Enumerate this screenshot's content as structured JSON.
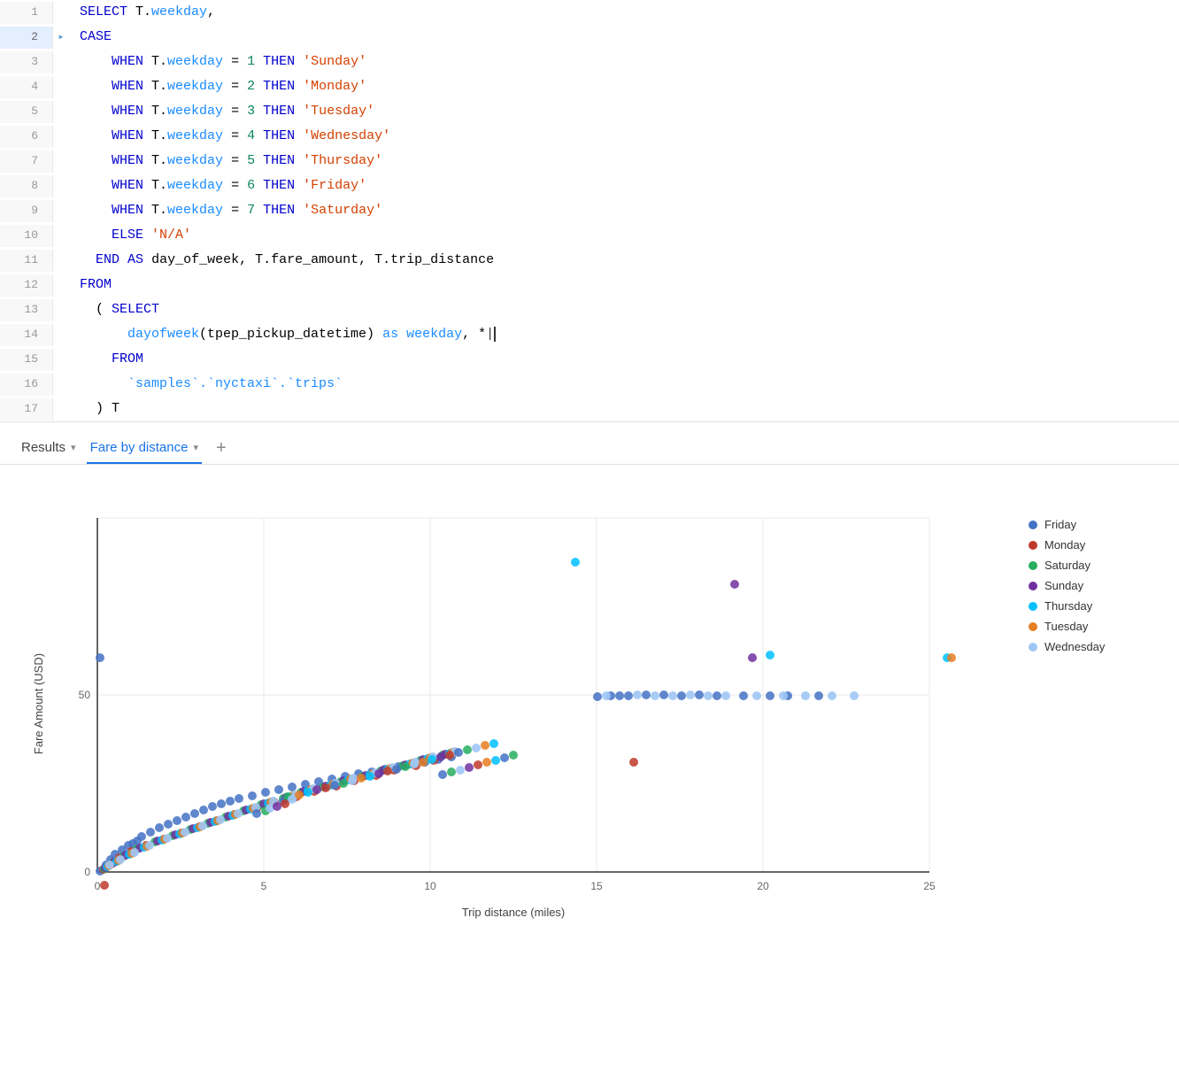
{
  "editor": {
    "lines": [
      {
        "number": "1",
        "active": false,
        "arrow": "",
        "tokens": [
          {
            "type": "kw",
            "text": "SELECT"
          },
          {
            "type": "plain",
            "text": " T."
          },
          {
            "type": "col",
            "text": "weekday"
          },
          {
            "type": "plain",
            "text": ","
          }
        ]
      },
      {
        "number": "2",
        "active": true,
        "arrow": "▸",
        "tokens": [
          {
            "type": "kw",
            "text": "CASE"
          }
        ]
      },
      {
        "number": "3",
        "active": false,
        "arrow": "",
        "tokens": [
          {
            "type": "plain",
            "text": "    "
          },
          {
            "type": "kw",
            "text": "WHEN"
          },
          {
            "type": "plain",
            "text": " T."
          },
          {
            "type": "col",
            "text": "weekday"
          },
          {
            "type": "plain",
            "text": " = "
          },
          {
            "type": "num",
            "text": "1"
          },
          {
            "type": "plain",
            "text": " "
          },
          {
            "type": "kw",
            "text": "THEN"
          },
          {
            "type": "plain",
            "text": " "
          },
          {
            "type": "str",
            "text": "'Sunday'"
          }
        ]
      },
      {
        "number": "4",
        "active": false,
        "arrow": "",
        "tokens": [
          {
            "type": "plain",
            "text": "    "
          },
          {
            "type": "kw",
            "text": "WHEN"
          },
          {
            "type": "plain",
            "text": " T."
          },
          {
            "type": "col",
            "text": "weekday"
          },
          {
            "type": "plain",
            "text": " = "
          },
          {
            "type": "num",
            "text": "2"
          },
          {
            "type": "plain",
            "text": " "
          },
          {
            "type": "kw",
            "text": "THEN"
          },
          {
            "type": "plain",
            "text": " "
          },
          {
            "type": "str",
            "text": "'Monday'"
          }
        ]
      },
      {
        "number": "5",
        "active": false,
        "arrow": "",
        "tokens": [
          {
            "type": "plain",
            "text": "    "
          },
          {
            "type": "kw",
            "text": "WHEN"
          },
          {
            "type": "plain",
            "text": " T."
          },
          {
            "type": "col",
            "text": "weekday"
          },
          {
            "type": "plain",
            "text": " = "
          },
          {
            "type": "num",
            "text": "3"
          },
          {
            "type": "plain",
            "text": " "
          },
          {
            "type": "kw",
            "text": "THEN"
          },
          {
            "type": "plain",
            "text": " "
          },
          {
            "type": "str",
            "text": "'Tuesday'"
          }
        ]
      },
      {
        "number": "6",
        "active": false,
        "arrow": "",
        "tokens": [
          {
            "type": "plain",
            "text": "    "
          },
          {
            "type": "kw",
            "text": "WHEN"
          },
          {
            "type": "plain",
            "text": " T."
          },
          {
            "type": "col",
            "text": "weekday"
          },
          {
            "type": "plain",
            "text": " = "
          },
          {
            "type": "num",
            "text": "4"
          },
          {
            "type": "plain",
            "text": " "
          },
          {
            "type": "kw",
            "text": "THEN"
          },
          {
            "type": "plain",
            "text": " "
          },
          {
            "type": "str",
            "text": "'Wednesday'"
          }
        ]
      },
      {
        "number": "7",
        "active": false,
        "arrow": "",
        "tokens": [
          {
            "type": "plain",
            "text": "    "
          },
          {
            "type": "kw",
            "text": "WHEN"
          },
          {
            "type": "plain",
            "text": " T."
          },
          {
            "type": "col",
            "text": "weekday"
          },
          {
            "type": "plain",
            "text": " = "
          },
          {
            "type": "num",
            "text": "5"
          },
          {
            "type": "plain",
            "text": " "
          },
          {
            "type": "kw",
            "text": "THEN"
          },
          {
            "type": "plain",
            "text": " "
          },
          {
            "type": "str",
            "text": "'Thursday'"
          }
        ]
      },
      {
        "number": "8",
        "active": false,
        "arrow": "",
        "tokens": [
          {
            "type": "plain",
            "text": "    "
          },
          {
            "type": "kw",
            "text": "WHEN"
          },
          {
            "type": "plain",
            "text": " T."
          },
          {
            "type": "col",
            "text": "weekday"
          },
          {
            "type": "plain",
            "text": " = "
          },
          {
            "type": "num",
            "text": "6"
          },
          {
            "type": "plain",
            "text": " "
          },
          {
            "type": "kw",
            "text": "THEN"
          },
          {
            "type": "plain",
            "text": " "
          },
          {
            "type": "str",
            "text": "'Friday'"
          }
        ]
      },
      {
        "number": "9",
        "active": false,
        "arrow": "",
        "tokens": [
          {
            "type": "plain",
            "text": "    "
          },
          {
            "type": "kw",
            "text": "WHEN"
          },
          {
            "type": "plain",
            "text": " T."
          },
          {
            "type": "col",
            "text": "weekday"
          },
          {
            "type": "plain",
            "text": " = "
          },
          {
            "type": "num",
            "text": "7"
          },
          {
            "type": "plain",
            "text": " "
          },
          {
            "type": "kw",
            "text": "THEN"
          },
          {
            "type": "plain",
            "text": " "
          },
          {
            "type": "str",
            "text": "'Saturday'"
          }
        ]
      },
      {
        "number": "10",
        "active": false,
        "arrow": "",
        "tokens": [
          {
            "type": "plain",
            "text": "    "
          },
          {
            "type": "kw",
            "text": "ELSE"
          },
          {
            "type": "plain",
            "text": " "
          },
          {
            "type": "str",
            "text": "'N/A'"
          }
        ]
      },
      {
        "number": "11",
        "active": false,
        "arrow": "",
        "tokens": [
          {
            "type": "plain",
            "text": "  "
          },
          {
            "type": "kw",
            "text": "END"
          },
          {
            "type": "plain",
            "text": " "
          },
          {
            "type": "kw",
            "text": "AS"
          },
          {
            "type": "plain",
            "text": " day_of_week, T.fare_amount, T.trip_distance"
          }
        ]
      },
      {
        "number": "12",
        "active": false,
        "arrow": "",
        "tokens": [
          {
            "type": "kw",
            "text": "FROM"
          }
        ]
      },
      {
        "number": "13",
        "active": false,
        "arrow": "",
        "tokens": [
          {
            "type": "plain",
            "text": "  ( "
          },
          {
            "type": "kw",
            "text": "SELECT"
          }
        ]
      },
      {
        "number": "14",
        "active": false,
        "arrow": "",
        "tokens": [
          {
            "type": "plain",
            "text": "      "
          },
          {
            "type": "fn",
            "text": "dayofweek"
          },
          {
            "type": "plain",
            "text": "(tpep_pickup_datetime) "
          },
          {
            "type": "kw2",
            "text": "as"
          },
          {
            "type": "plain",
            "text": " "
          },
          {
            "type": "col",
            "text": "weekday"
          },
          {
            "type": "plain",
            "text": ", *"
          },
          {
            "type": "cursor",
            "text": "|"
          }
        ]
      },
      {
        "number": "15",
        "active": false,
        "arrow": "",
        "tokens": [
          {
            "type": "plain",
            "text": "    "
          },
          {
            "type": "kw",
            "text": "FROM"
          }
        ]
      },
      {
        "number": "16",
        "active": false,
        "arrow": "",
        "tokens": [
          {
            "type": "plain",
            "text": "      "
          },
          {
            "type": "tick",
            "text": "`samples`.`nyctaxi`.`trips`"
          }
        ]
      },
      {
        "number": "17",
        "active": false,
        "arrow": "",
        "tokens": [
          {
            "type": "plain",
            "text": "  ) T"
          }
        ]
      }
    ]
  },
  "results_tabs": {
    "tabs": [
      {
        "label": "Results",
        "active": false
      },
      {
        "label": "Fare by distance",
        "active": true
      },
      {
        "label": "+",
        "active": false
      }
    ]
  },
  "chart": {
    "title": "Fare by distance",
    "x_label": "Trip distance (miles)",
    "y_label": "Fare Amount (USD)",
    "x_ticks": [
      "0",
      "5",
      "10",
      "15",
      "20",
      "25"
    ],
    "y_ticks": [
      "0",
      "50"
    ],
    "legend": [
      {
        "label": "Friday",
        "color": "#4472C4"
      },
      {
        "label": "Monday",
        "color": "#c0392b"
      },
      {
        "label": "Saturday",
        "color": "#27ae60"
      },
      {
        "label": "Sunday",
        "color": "#7030A0"
      },
      {
        "label": "Thursday",
        "color": "#00BFFF"
      },
      {
        "label": "Tuesday",
        "color": "#E67E22"
      },
      {
        "label": "Wednesday",
        "color": "#9EC6F5"
      }
    ]
  }
}
